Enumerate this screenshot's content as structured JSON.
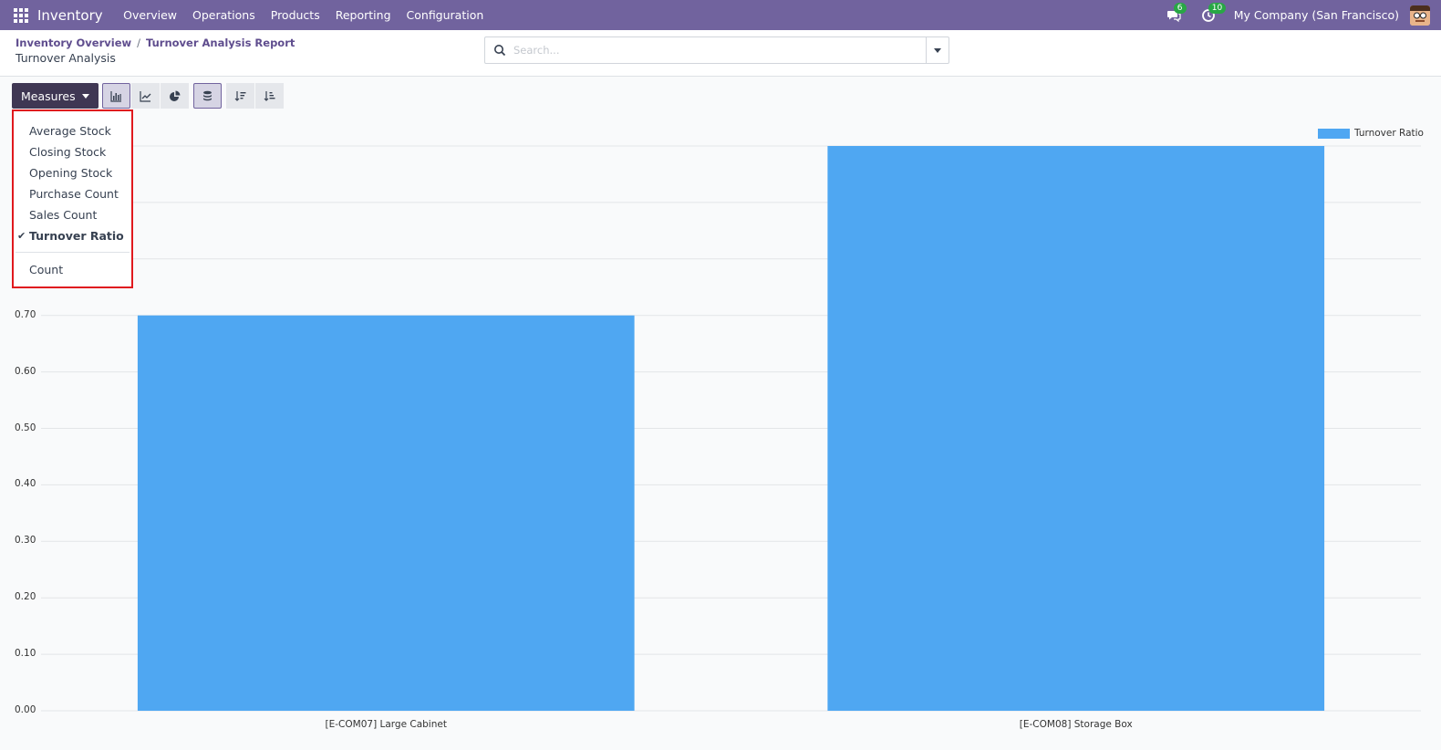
{
  "navbar": {
    "app_name": "Inventory",
    "menu": [
      "Overview",
      "Operations",
      "Products",
      "Reporting",
      "Configuration"
    ],
    "messages_count": "6",
    "activities_count": "10",
    "company": "My Company (San Francisco)"
  },
  "breadcrumb": {
    "items": [
      "Inventory Overview",
      "Turnover Analysis Report"
    ],
    "current": "Turnover Analysis"
  },
  "search": {
    "placeholder": "Search..."
  },
  "toolbar": {
    "measures_label": "Measures",
    "icons": [
      "bar-chart-icon",
      "line-chart-icon",
      "pie-chart-icon",
      "stacked-icon",
      "sort-descending-icon",
      "sort-ascending-icon"
    ]
  },
  "measures_dropdown": {
    "items": [
      {
        "label": "Average Stock",
        "selected": false
      },
      {
        "label": "Closing Stock",
        "selected": false
      },
      {
        "label": "Opening Stock",
        "selected": false
      },
      {
        "label": "Purchase Count",
        "selected": false
      },
      {
        "label": "Sales Count",
        "selected": false
      },
      {
        "label": "Turnover Ratio",
        "selected": true
      }
    ],
    "extra_item": "Count"
  },
  "colors": {
    "navbar": "#71639e",
    "bar": "#4fa7f2",
    "highlight": "#e0191e"
  },
  "chart_data": {
    "type": "bar",
    "categories": [
      "[E-COM07] Large Cabinet",
      "[E-COM08] Storage Box"
    ],
    "series": [
      {
        "name": "Turnover Ratio",
        "values": [
          0.7,
          1.0
        ]
      }
    ],
    "yticks": [
      "0.00",
      "0.10",
      "0.20",
      "0.30",
      "0.40",
      "0.50",
      "0.60",
      "0.70"
    ],
    "ylim": [
      0,
      1.0
    ],
    "grid": true,
    "legend_position": "top-right"
  }
}
